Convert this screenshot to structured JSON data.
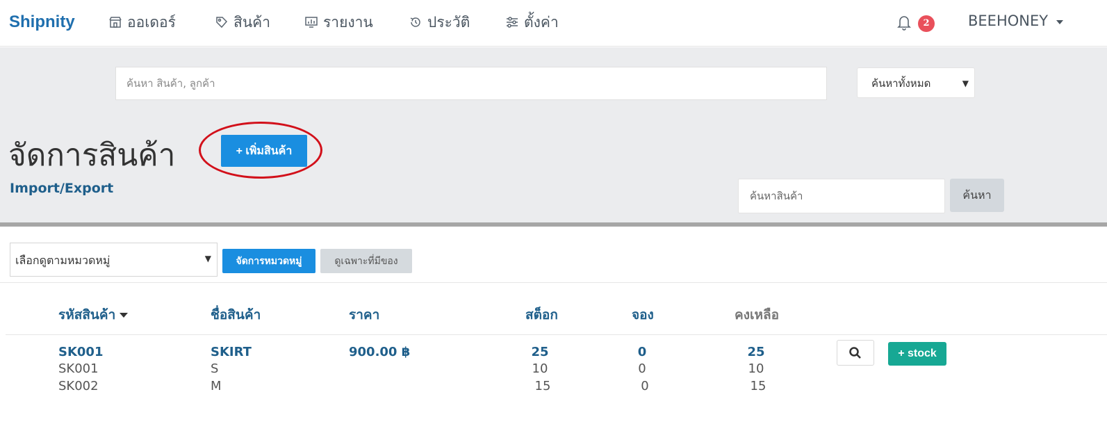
{
  "nav": {
    "brand": "Shipnity",
    "items": [
      {
        "label": "ออเดอร์",
        "icon": "store-icon"
      },
      {
        "label": "สินค้า",
        "icon": "tag-icon"
      },
      {
        "label": "รายงาน",
        "icon": "chart-icon"
      },
      {
        "label": "ประวัติ",
        "icon": "history-icon"
      },
      {
        "label": "ตั้งค่า",
        "icon": "sliders-icon"
      }
    ],
    "notification_count": "2",
    "user": "BEEHONEY"
  },
  "search": {
    "placeholder": "ค้นหา   สินค้า, ลูกค้า",
    "scope": "ค้นหาทั้งหมด"
  },
  "page": {
    "title": "จัดการสินค้า",
    "add_button": "+ เพิ่มสินค้า",
    "import_export": "Import/Export",
    "product_search_placeholder": "ค้นหาสินค้า",
    "search_button": "ค้นหา"
  },
  "filters": {
    "category_select": "เลือกดูตามหมวดหมู่",
    "manage_categories": "จัดการหมวดหมู่",
    "in_stock_only": "ดูเฉพาะที่มีของ"
  },
  "table": {
    "headers": {
      "sku": "รหัสสินค้า",
      "name": "ชื่อสินค้า",
      "price": "ราคา",
      "stock": "สต็อก",
      "reserved": "จอง",
      "remaining": "คงเหลือ"
    },
    "product": {
      "sku": "SK001",
      "name": "SKIRT",
      "price": "900.00 ฿",
      "stock": "25",
      "reserved": "0",
      "remaining": "25",
      "add_stock_button": "+ stock"
    },
    "variants": [
      {
        "sku": "SK001",
        "name": "S",
        "stock": "10",
        "reserved": "0",
        "remaining": "10"
      },
      {
        "sku": "SK002",
        "name": "M",
        "stock": "15",
        "reserved": "0",
        "remaining": "15"
      }
    ]
  },
  "colors": {
    "primary": "#1a8ee0",
    "brand": "#1f6fae",
    "success": "#17a894",
    "badge": "#e9505b",
    "annotation": "#d2101a"
  }
}
